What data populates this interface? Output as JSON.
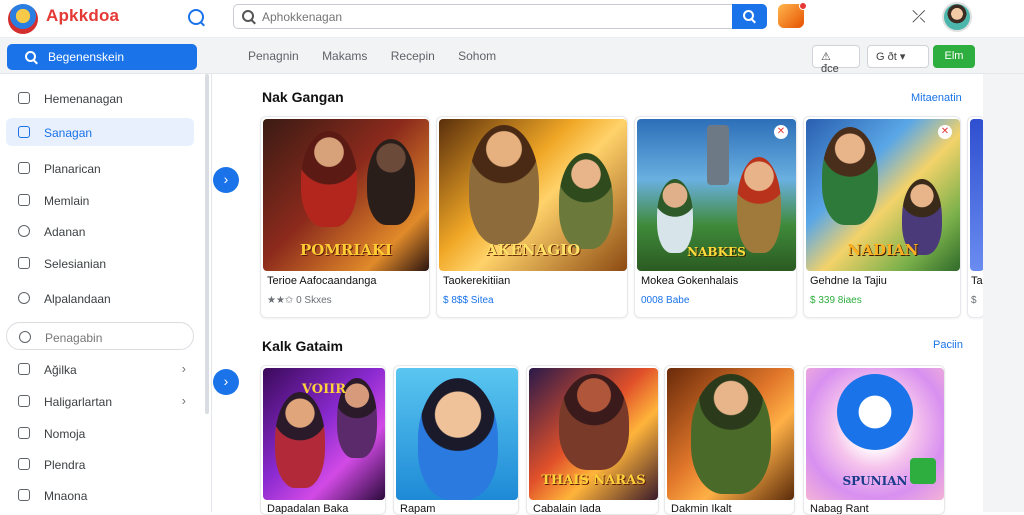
{
  "header": {
    "brand": "Apkkdoa",
    "search_placeholder": "Aphokkenagan"
  },
  "subbar": {
    "nav_button": "Begenenskein",
    "categories": [
      "Penagnin",
      "Makams",
      "Recepin",
      "Sohom"
    ],
    "pill1": "⚠ đce",
    "pill2": "G ðt",
    "pill3": "Elm"
  },
  "sidebar": {
    "items": [
      {
        "label": "Hemenanagan"
      },
      {
        "label": "Sanagan"
      },
      {
        "label": "Planarican"
      },
      {
        "label": "Memlain"
      },
      {
        "label": "Adanan"
      },
      {
        "label": "Selesianian"
      },
      {
        "label": "Alpalandaan"
      },
      {
        "label": "Penagabin"
      },
      {
        "label": "Ağilka"
      },
      {
        "label": "Haligarlartan"
      },
      {
        "label": "Nomoja"
      },
      {
        "label": "Plendra"
      },
      {
        "label": "Mnaona"
      }
    ]
  },
  "section1": {
    "title": "Nak Gangan",
    "link": "Mitaenatin",
    "cards": [
      {
        "name": "Terioe Aafocaandanga",
        "meta": "★★✩ 0 Skxes",
        "art_text": "POMRIAKI"
      },
      {
        "name": "Taokerekitiian",
        "meta": "$ 8$$ Sitea",
        "art_text": "AKENAGIO"
      },
      {
        "name": "Mokea Gokenhalais",
        "meta": "0008 Babe",
        "art_text": "NABKES"
      },
      {
        "name": "Gehdne Ia Tajiu",
        "meta": "$ 339 8iaes",
        "art_text": "NADIAN"
      },
      {
        "name": "Ta",
        "meta": "$",
        "art_text": ""
      }
    ]
  },
  "section2": {
    "title": "Kalk Gataim",
    "link": "Paciin",
    "cards": [
      {
        "name": "Dapadalan Baka",
        "art_text": "VOIIR"
      },
      {
        "name": "Rapam",
        "art_text": ""
      },
      {
        "name": "Cabalain Iada",
        "art_text": "THAIS NARAS"
      },
      {
        "name": "Dakmin Ikalt",
        "art_text": ""
      },
      {
        "name": "Nabag Rant",
        "art_text": "SPUNIAN"
      }
    ]
  },
  "colors": {
    "accent": "#1a73e8",
    "green": "#2eae3e",
    "brand": "#e53935"
  }
}
